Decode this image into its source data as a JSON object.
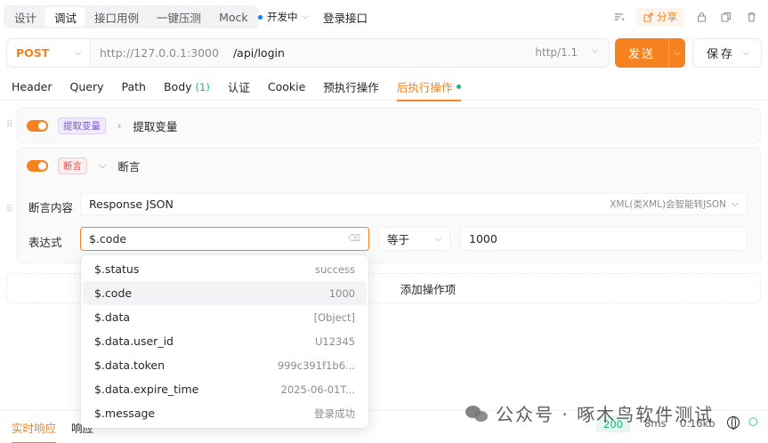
{
  "mode_tabs": [
    "设计",
    "调试",
    "接口用例",
    "一键压测",
    "Mock"
  ],
  "environment": "开发中",
  "api_name": "登录接口",
  "share_label": "分享",
  "request": {
    "method": "POST",
    "base_url": "http://127.0.0.1:3000",
    "path": "/api/login",
    "protocol": "http/1.1",
    "send_label": "发送",
    "save_label": "保存"
  },
  "section_tabs": {
    "header": "Header",
    "query": "Query",
    "path": "Path",
    "body": "Body",
    "body_count": "(1)",
    "auth": "认证",
    "cookie": "Cookie",
    "pre": "预执行操作",
    "post": "后执行操作"
  },
  "extract_card": {
    "tag": "提取变量",
    "title": "提取变量",
    "enabled": true
  },
  "assert_card": {
    "tag": "断言",
    "title": "断言",
    "enabled": true,
    "source_label": "断言内容",
    "source_value": "Response JSON",
    "source_hint": "XML(类XML)会智能转JSON",
    "expr_label": "表达式",
    "expr_value": "$.code",
    "operator": "等于",
    "expected": "1000"
  },
  "add_operation": "添加操作项",
  "suggestions": [
    {
      "path": "$.status",
      "value": "success"
    },
    {
      "path": "$.code",
      "value": "1000"
    },
    {
      "path": "$.data",
      "value": "[Object]"
    },
    {
      "path": "$.data.user_id",
      "value": "U12345"
    },
    {
      "path": "$.data.token",
      "value": "999c391f1b6..."
    },
    {
      "path": "$.data.expire_time",
      "value": "2025-06-01T..."
    },
    {
      "path": "$.message",
      "value": "登录成功"
    }
  ],
  "bottom": {
    "realtime_tab": "实时响应",
    "response_tab": "响应",
    "status_code": "200",
    "time": "8ms",
    "size": "0.16kb"
  },
  "watermark": "公众号 · 啄木鸟软件测试",
  "colors": {
    "accent": "#f5821f",
    "success": "#10b981",
    "link": "#1677ff"
  }
}
